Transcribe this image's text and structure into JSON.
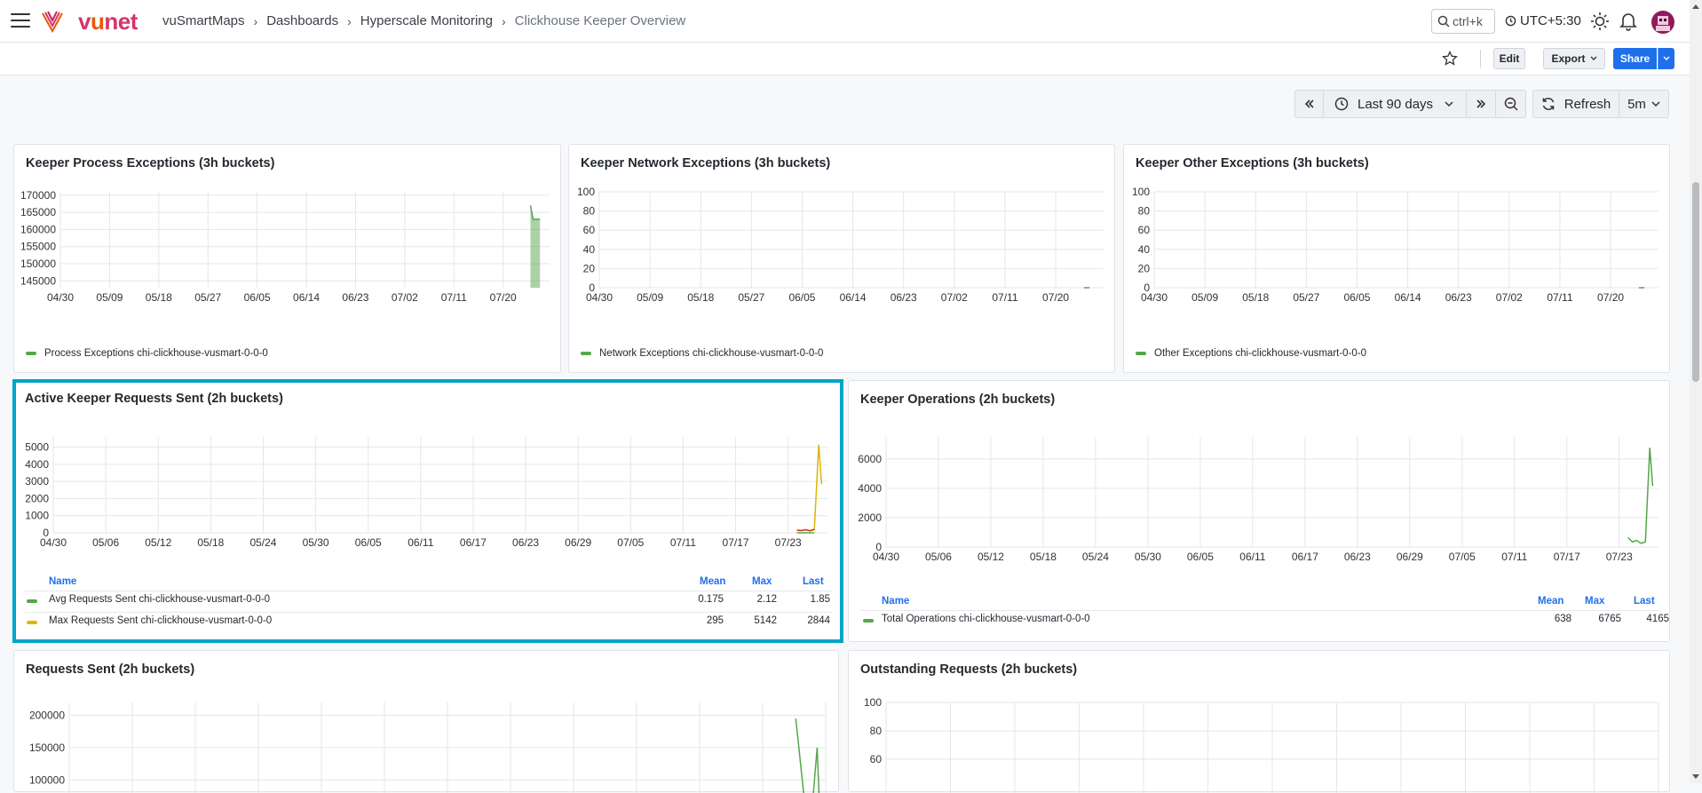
{
  "header": {
    "logo_text_1": "v",
    "logo_text_2": "u",
    "logo_text_3": "net",
    "breadcrumbs": [
      "vuSmartMaps",
      "Dashboards",
      "Hyperscale Monitoring",
      "Clickhouse Keeper Overview"
    ],
    "search_placeholder": "ctrl+k",
    "timezone": "UTC+5:30"
  },
  "toolbar": {
    "edit_label": "Edit",
    "export_label": "Export",
    "share_label": "Share"
  },
  "time_controls": {
    "range_label": "Last 90 days",
    "refresh_label": "Refresh",
    "interval_label": "5m"
  },
  "colors": {
    "accent_blue": "#1f6feb",
    "selection_border": "#00a4c7",
    "series_green": "#56a64b",
    "series_yellow": "#e0b400",
    "series_red": "#d0311f"
  },
  "panels": {
    "p1": {
      "title": "Keeper Process Exceptions (3h buckets)",
      "legend": [
        "Process Exceptions chi-clickhouse-vusmart-0-0-0"
      ]
    },
    "p2": {
      "title": "Keeper Network Exceptions (3h buckets)",
      "legend": [
        "Network Exceptions chi-clickhouse-vusmart-0-0-0"
      ]
    },
    "p3": {
      "title": "Keeper Other Exceptions (3h buckets)",
      "legend": [
        "Other Exceptions chi-clickhouse-vusmart-0-0-0"
      ]
    },
    "p4": {
      "title": "Active Keeper Requests Sent (2h buckets)",
      "legend_headers": [
        "Name",
        "Mean",
        "Max",
        "Last"
      ],
      "legend_rows": [
        {
          "name": "Avg Requests Sent chi-clickhouse-vusmart-0-0-0",
          "mean": "0.175",
          "max": "2.12",
          "last": "1.85"
        },
        {
          "name": "Max Requests Sent chi-clickhouse-vusmart-0-0-0",
          "mean": "295",
          "max": "5142",
          "last": "2844"
        }
      ]
    },
    "p5": {
      "title": "Keeper Operations (2h buckets)",
      "legend_headers": [
        "Name",
        "Mean",
        "Max",
        "Last"
      ],
      "legend_rows": [
        {
          "name": "Total Operations chi-clickhouse-vusmart-0-0-0",
          "mean": "638",
          "max": "6765",
          "last": "4165"
        }
      ]
    },
    "p6": {
      "title": "Requests Sent (2h buckets)"
    },
    "p7": {
      "title": "Outstanding Requests (2h buckets)"
    }
  },
  "chart_data": [
    {
      "type": "area",
      "title": "Keeper Process Exceptions (3h buckets)",
      "x_ticks": [
        "04/30",
        "05/09",
        "05/18",
        "05/27",
        "06/05",
        "06/14",
        "06/23",
        "07/02",
        "07/11",
        "07/20"
      ],
      "y_ticks": [
        145000,
        150000,
        155000,
        160000,
        165000,
        170000
      ],
      "ylim": [
        143000,
        171000
      ],
      "series": [
        {
          "name": "Process Exceptions chi-clickhouse-vusmart-0-0-0",
          "x": [
            "07/25 00:00",
            "07/25 12:00",
            "07/25 18:00",
            "07/26 18:00"
          ],
          "values": [
            167000,
            163000,
            163000,
            163000
          ]
        }
      ]
    },
    {
      "type": "line",
      "title": "Keeper Network Exceptions (3h buckets)",
      "x_ticks": [
        "04/30",
        "05/09",
        "05/18",
        "05/27",
        "06/05",
        "06/14",
        "06/23",
        "07/02",
        "07/11",
        "07/20"
      ],
      "y_ticks": [
        0,
        20,
        40,
        60,
        80,
        100
      ],
      "ylim": [
        0,
        100
      ],
      "series": [
        {
          "name": "Network Exceptions chi-clickhouse-vusmart-0-0-0",
          "x": [
            "07/25",
            "07/26"
          ],
          "values": [
            0,
            0
          ]
        }
      ]
    },
    {
      "type": "line",
      "title": "Keeper Other Exceptions (3h buckets)",
      "x_ticks": [
        "04/30",
        "05/09",
        "05/18",
        "05/27",
        "06/05",
        "06/14",
        "06/23",
        "07/02",
        "07/11",
        "07/20"
      ],
      "y_ticks": [
        0,
        20,
        40,
        60,
        80,
        100
      ],
      "ylim": [
        0,
        100
      ],
      "series": [
        {
          "name": "Other Exceptions chi-clickhouse-vusmart-0-0-0",
          "x": [
            "07/25",
            "07/26"
          ],
          "values": [
            0,
            0
          ]
        }
      ]
    },
    {
      "type": "line",
      "title": "Active Keeper Requests Sent (2h buckets)",
      "x_ticks": [
        "04/30",
        "05/06",
        "05/12",
        "05/18",
        "05/24",
        "05/30",
        "06/05",
        "06/11",
        "06/17",
        "06/23",
        "06/29",
        "07/05",
        "07/11",
        "07/17",
        "07/23"
      ],
      "y_ticks": [
        0,
        1000,
        2000,
        3000,
        4000,
        5000
      ],
      "ylim": [
        0,
        5600
      ],
      "series": [
        {
          "name": "Avg Requests Sent chi-clickhouse-vusmart-0-0-0",
          "x": [
            "07/24",
            "07/25",
            "07/26"
          ],
          "values": [
            0.2,
            0.3,
            1.85
          ]
        },
        {
          "name": "Max Requests Sent chi-clickhouse-vusmart-0-0-0",
          "x": [
            "07/24",
            "07/24 12:00",
            "07/25",
            "07/25 12:00",
            "07/26",
            "07/26 12:00",
            "07/26 20:00"
          ],
          "values": [
            150,
            130,
            180,
            120,
            200,
            5142,
            2844
          ]
        }
      ]
    },
    {
      "type": "line",
      "title": "Keeper Operations (2h buckets)",
      "x_ticks": [
        "04/30",
        "05/06",
        "05/12",
        "05/18",
        "05/24",
        "05/30",
        "06/05",
        "06/11",
        "06/17",
        "06/23",
        "06/29",
        "07/05",
        "07/11",
        "07/17",
        "07/23"
      ],
      "y_ticks": [
        0,
        2000,
        4000,
        6000
      ],
      "ylim": [
        0,
        7500
      ],
      "series": [
        {
          "name": "Total Operations chi-clickhouse-vusmart-0-0-0",
          "x": [
            "07/24",
            "07/24 12:00",
            "07/25",
            "07/25 12:00",
            "07/26",
            "07/26 12:00",
            "07/26 20:00"
          ],
          "values": [
            650,
            350,
            450,
            250,
            350,
            6765,
            4165
          ]
        }
      ]
    },
    {
      "type": "line",
      "title": "Requests Sent (2h buckets)",
      "y_ticks": [
        100000,
        150000,
        200000
      ],
      "ylim": [
        0,
        220000
      ],
      "series": [
        {
          "x": [
            "07/24",
            "07/25",
            "07/26",
            "07/26 12:00",
            "07/26 20:00"
          ],
          "values": [
            195000,
            70000,
            70000,
            150000,
            40000
          ]
        }
      ]
    },
    {
      "type": "line",
      "title": "Outstanding Requests (2h buckets)",
      "y_ticks": [
        60,
        80,
        100
      ],
      "ylim": [
        0,
        100
      ],
      "series": []
    }
  ]
}
